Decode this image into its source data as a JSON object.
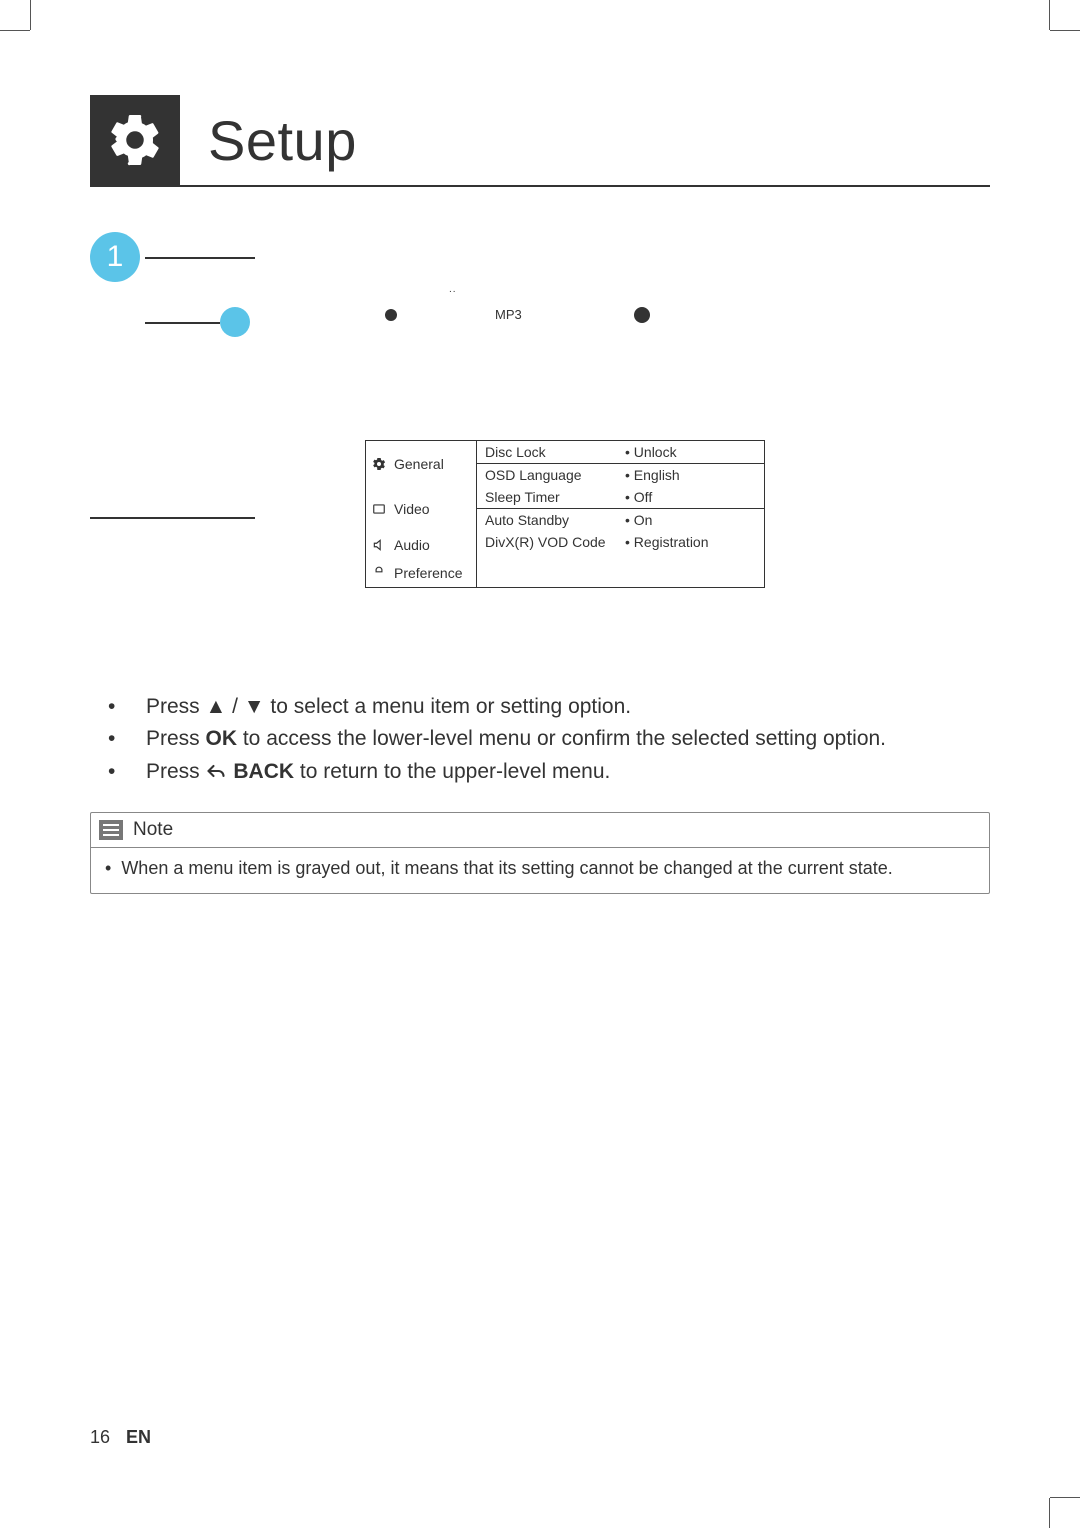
{
  "header": {
    "title": "Setup"
  },
  "diagram": {
    "step_number": "1",
    "remote_label": "MP3"
  },
  "osd": {
    "tabs": {
      "general": "General",
      "video": "Video",
      "audio": "Audio",
      "preference": "Preference"
    },
    "items": [
      {
        "label": "Disc Lock",
        "value": "Unlock"
      },
      {
        "label": "OSD Language",
        "value": "English"
      },
      {
        "label": "Sleep Timer",
        "value": "Off"
      },
      {
        "label": "Auto Standby",
        "value": "On"
      },
      {
        "label": "DivX(R) VOD Code",
        "value": "Registration"
      }
    ]
  },
  "instructions": {
    "line1_pre": "Press ",
    "line1_sym": "▲ / ▼",
    "line1_post": " to select a menu item or setting option.",
    "line2_pre": "Press ",
    "line2_bold": "OK",
    "line2_post": " to access the lower-level menu or confirm the selected setting option.",
    "line3_pre": "Press ",
    "line3_bold": "BACK",
    "line3_post": " to return to the upper-level menu."
  },
  "note": {
    "title": "Note",
    "body": "When a menu item is grayed out, it means that its setting cannot be changed at the current state."
  },
  "footer": {
    "page": "16",
    "lang": "EN"
  }
}
